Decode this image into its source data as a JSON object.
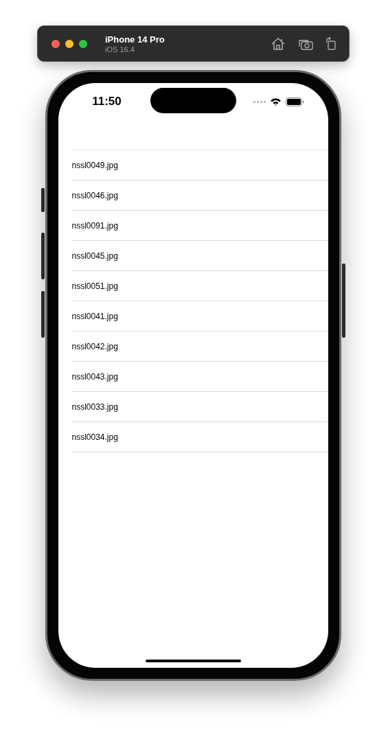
{
  "simulator": {
    "device": "iPhone 14 Pro",
    "os": "iOS 16.4"
  },
  "status_bar": {
    "time": "11:50"
  },
  "files": [
    "nssl0049.jpg",
    "nssl0046.jpg",
    "nssl0091.jpg",
    "nssl0045.jpg",
    "nssl0051.jpg",
    "nssl0041.jpg",
    "nssl0042.jpg",
    "nssl0043.jpg",
    "nssl0033.jpg",
    "nssl0034.jpg"
  ]
}
